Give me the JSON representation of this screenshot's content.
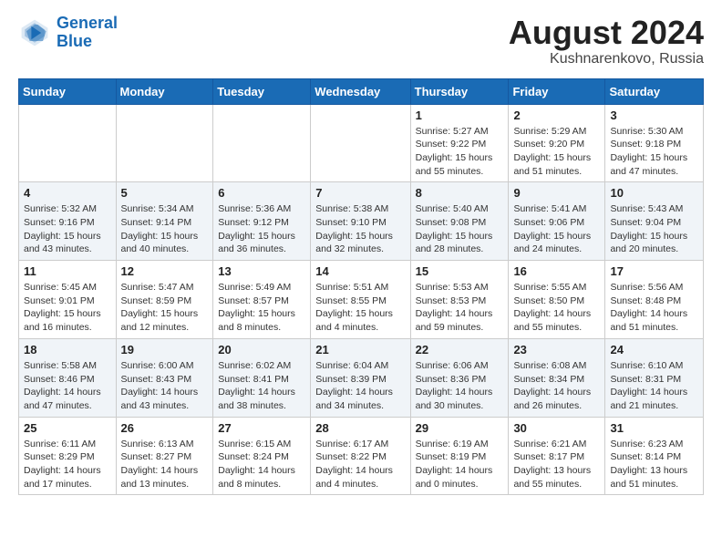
{
  "header": {
    "logo_line1": "General",
    "logo_line2": "Blue",
    "title": "August 2024",
    "subtitle": "Kushnarenkovo, Russia"
  },
  "weekdays": [
    "Sunday",
    "Monday",
    "Tuesday",
    "Wednesday",
    "Thursday",
    "Friday",
    "Saturday"
  ],
  "weeks": [
    [
      {
        "day": "",
        "info": ""
      },
      {
        "day": "",
        "info": ""
      },
      {
        "day": "",
        "info": ""
      },
      {
        "day": "",
        "info": ""
      },
      {
        "day": "1",
        "info": "Sunrise: 5:27 AM\nSunset: 9:22 PM\nDaylight: 15 hours\nand 55 minutes."
      },
      {
        "day": "2",
        "info": "Sunrise: 5:29 AM\nSunset: 9:20 PM\nDaylight: 15 hours\nand 51 minutes."
      },
      {
        "day": "3",
        "info": "Sunrise: 5:30 AM\nSunset: 9:18 PM\nDaylight: 15 hours\nand 47 minutes."
      }
    ],
    [
      {
        "day": "4",
        "info": "Sunrise: 5:32 AM\nSunset: 9:16 PM\nDaylight: 15 hours\nand 43 minutes."
      },
      {
        "day": "5",
        "info": "Sunrise: 5:34 AM\nSunset: 9:14 PM\nDaylight: 15 hours\nand 40 minutes."
      },
      {
        "day": "6",
        "info": "Sunrise: 5:36 AM\nSunset: 9:12 PM\nDaylight: 15 hours\nand 36 minutes."
      },
      {
        "day": "7",
        "info": "Sunrise: 5:38 AM\nSunset: 9:10 PM\nDaylight: 15 hours\nand 32 minutes."
      },
      {
        "day": "8",
        "info": "Sunrise: 5:40 AM\nSunset: 9:08 PM\nDaylight: 15 hours\nand 28 minutes."
      },
      {
        "day": "9",
        "info": "Sunrise: 5:41 AM\nSunset: 9:06 PM\nDaylight: 15 hours\nand 24 minutes."
      },
      {
        "day": "10",
        "info": "Sunrise: 5:43 AM\nSunset: 9:04 PM\nDaylight: 15 hours\nand 20 minutes."
      }
    ],
    [
      {
        "day": "11",
        "info": "Sunrise: 5:45 AM\nSunset: 9:01 PM\nDaylight: 15 hours\nand 16 minutes."
      },
      {
        "day": "12",
        "info": "Sunrise: 5:47 AM\nSunset: 8:59 PM\nDaylight: 15 hours\nand 12 minutes."
      },
      {
        "day": "13",
        "info": "Sunrise: 5:49 AM\nSunset: 8:57 PM\nDaylight: 15 hours\nand 8 minutes."
      },
      {
        "day": "14",
        "info": "Sunrise: 5:51 AM\nSunset: 8:55 PM\nDaylight: 15 hours\nand 4 minutes."
      },
      {
        "day": "15",
        "info": "Sunrise: 5:53 AM\nSunset: 8:53 PM\nDaylight: 14 hours\nand 59 minutes."
      },
      {
        "day": "16",
        "info": "Sunrise: 5:55 AM\nSunset: 8:50 PM\nDaylight: 14 hours\nand 55 minutes."
      },
      {
        "day": "17",
        "info": "Sunrise: 5:56 AM\nSunset: 8:48 PM\nDaylight: 14 hours\nand 51 minutes."
      }
    ],
    [
      {
        "day": "18",
        "info": "Sunrise: 5:58 AM\nSunset: 8:46 PM\nDaylight: 14 hours\nand 47 minutes."
      },
      {
        "day": "19",
        "info": "Sunrise: 6:00 AM\nSunset: 8:43 PM\nDaylight: 14 hours\nand 43 minutes."
      },
      {
        "day": "20",
        "info": "Sunrise: 6:02 AM\nSunset: 8:41 PM\nDaylight: 14 hours\nand 38 minutes."
      },
      {
        "day": "21",
        "info": "Sunrise: 6:04 AM\nSunset: 8:39 PM\nDaylight: 14 hours\nand 34 minutes."
      },
      {
        "day": "22",
        "info": "Sunrise: 6:06 AM\nSunset: 8:36 PM\nDaylight: 14 hours\nand 30 minutes."
      },
      {
        "day": "23",
        "info": "Sunrise: 6:08 AM\nSunset: 8:34 PM\nDaylight: 14 hours\nand 26 minutes."
      },
      {
        "day": "24",
        "info": "Sunrise: 6:10 AM\nSunset: 8:31 PM\nDaylight: 14 hours\nand 21 minutes."
      }
    ],
    [
      {
        "day": "25",
        "info": "Sunrise: 6:11 AM\nSunset: 8:29 PM\nDaylight: 14 hours\nand 17 minutes."
      },
      {
        "day": "26",
        "info": "Sunrise: 6:13 AM\nSunset: 8:27 PM\nDaylight: 14 hours\nand 13 minutes."
      },
      {
        "day": "27",
        "info": "Sunrise: 6:15 AM\nSunset: 8:24 PM\nDaylight: 14 hours\nand 8 minutes."
      },
      {
        "day": "28",
        "info": "Sunrise: 6:17 AM\nSunset: 8:22 PM\nDaylight: 14 hours\nand 4 minutes."
      },
      {
        "day": "29",
        "info": "Sunrise: 6:19 AM\nSunset: 8:19 PM\nDaylight: 14 hours\nand 0 minutes."
      },
      {
        "day": "30",
        "info": "Sunrise: 6:21 AM\nSunset: 8:17 PM\nDaylight: 13 hours\nand 55 minutes."
      },
      {
        "day": "31",
        "info": "Sunrise: 6:23 AM\nSunset: 8:14 PM\nDaylight: 13 hours\nand 51 minutes."
      }
    ]
  ]
}
